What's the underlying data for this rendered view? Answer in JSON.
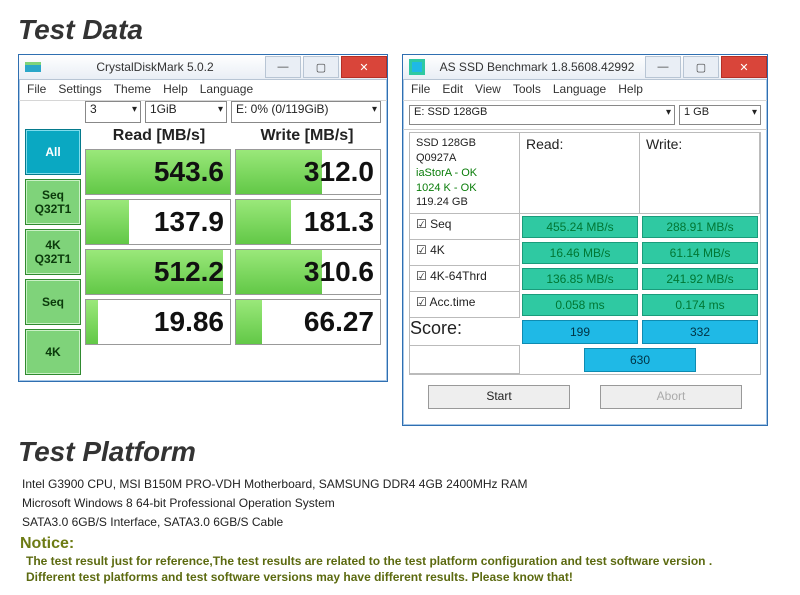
{
  "headings": {
    "test_data": "Test Data",
    "test_platform": "Test Platform",
    "notice": "Notice:"
  },
  "cdm": {
    "title": "CrystalDiskMark 5.0.2",
    "menu": [
      "File",
      "Settings",
      "Theme",
      "Help",
      "Language"
    ],
    "selects": {
      "runs": "3",
      "size": "1GiB",
      "drive": "E: 0% (0/119GiB)"
    },
    "headers": {
      "read": "Read [MB/s]",
      "write": "Write [MB/s]"
    },
    "buttons": {
      "all": "All",
      "seq_q32t1_a": "Seq",
      "seq_q32t1_b": "Q32T1",
      "k4_q32t1_a": "4K",
      "k4_q32t1_b": "Q32T1",
      "seq": "Seq",
      "k4": "4K"
    },
    "rows": [
      {
        "read": "543.6",
        "read_pct": 100,
        "write": "312.0",
        "write_pct": 60
      },
      {
        "read": "137.9",
        "read_pct": 30,
        "write": "181.3",
        "write_pct": 38
      },
      {
        "read": "512.2",
        "read_pct": 95,
        "write": "310.6",
        "write_pct": 60
      },
      {
        "read": "19.86",
        "read_pct": 8,
        "write": "66.27",
        "write_pct": 18
      }
    ]
  },
  "asssd": {
    "title": "AS SSD Benchmark 1.8.5608.42992",
    "menu": [
      "File",
      "Edit",
      "View",
      "Tools",
      "Language",
      "Help"
    ],
    "drive_select": "E: SSD 128GB",
    "size_select": "1 GB",
    "info": {
      "model": "SSD 128GB",
      "fw": "Q0927A",
      "driver": "iaStorA - OK",
      "align": "1024 K - OK",
      "capacity": "119.24 GB"
    },
    "headers": {
      "read": "Read:",
      "write": "Write:"
    },
    "rows": [
      {
        "label": "Seq",
        "read": "455.24 MB/s",
        "write": "288.91 MB/s"
      },
      {
        "label": "4K",
        "read": "16.46 MB/s",
        "write": "61.14 MB/s"
      },
      {
        "label": "4K-64Thrd",
        "read": "136.85 MB/s",
        "write": "241.92 MB/s"
      },
      {
        "label": "Acc.time",
        "read": "0.058 ms",
        "write": "0.174 ms"
      }
    ],
    "score": {
      "label": "Score:",
      "read": "199",
      "write": "332",
      "total": "630"
    },
    "buttons": {
      "start": "Start",
      "abort": "Abort"
    }
  },
  "platform": {
    "line1": "Intel G3900 CPU, MSI B150M PRO-VDH Motherboard, SAMSUNG DDR4 4GB 2400MHz RAM",
    "line2": "Microsoft Windows 8 64-bit Professional Operation System",
    "line3": "SATA3.0 6GB/S Interface,  SATA3.0 6GB/S Cable"
  },
  "notice": {
    "line1": "The test result just for reference,The test results are related to the test platform configuration and test software version .",
    "line2": "Different test platforms and test software versions may have different results. Please know that!"
  }
}
